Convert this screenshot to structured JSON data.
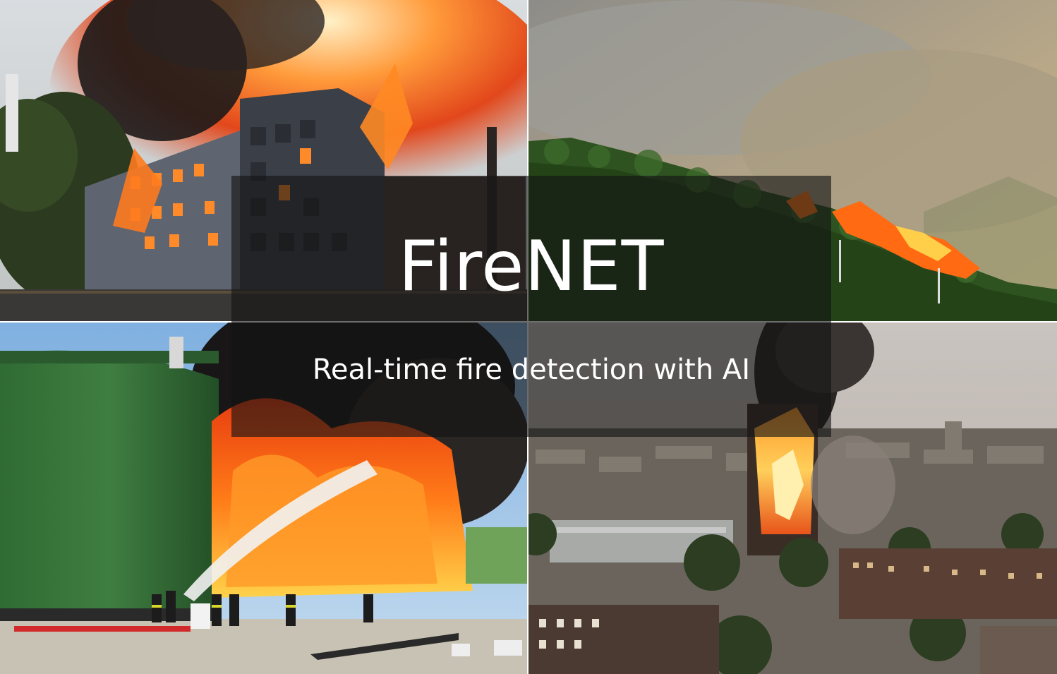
{
  "hero": {
    "title": "FireNET",
    "subtitle": "Real-time fire detection with AI"
  },
  "photos": [
    {
      "name": "burning-apartment-building"
    },
    {
      "name": "forest-wildfire-hillside"
    },
    {
      "name": "fuel-tank-fire-firefighters"
    },
    {
      "name": "high-rise-tower-fire-city"
    }
  ],
  "colors": {
    "overlay": "#141414",
    "title_text": "#ffffff",
    "fire_orange": "#ff6a1a",
    "smoke_grey": "#6b6b6b",
    "forest_green": "#2f5a22",
    "tank_green": "#2e6b33"
  }
}
